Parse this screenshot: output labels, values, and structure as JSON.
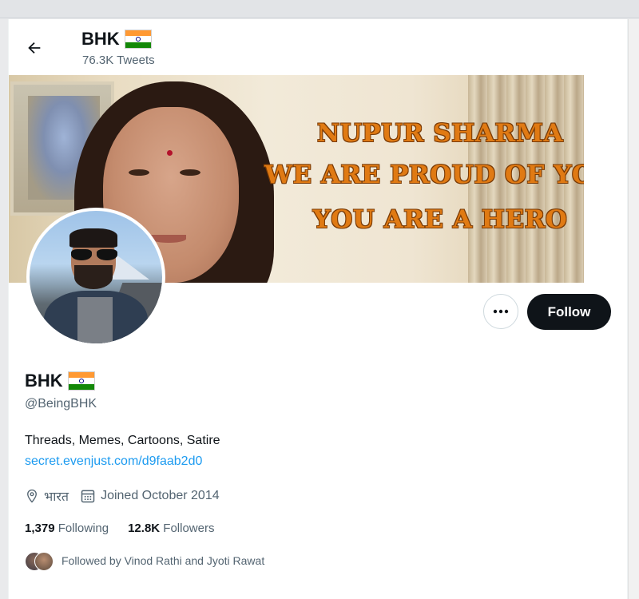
{
  "header": {
    "name": "BHK",
    "tweet_count": "76.3K Tweets"
  },
  "banner": {
    "line1": "NUPUR SHARMA",
    "line2": "WE ARE PROUD OF YOU",
    "line3": "YOU ARE A HERO"
  },
  "actions": {
    "more_icon": "more-dots-icon",
    "follow_label": "Follow"
  },
  "profile": {
    "name": "BHK",
    "handle": "@BeingBHK",
    "bio": "Threads, Memes, Cartoons, Satire",
    "link": "secret.evenjust.com/d9faab2d0",
    "location": "भारत",
    "joined": "Joined October 2014",
    "following_count": "1,379",
    "following_label": "Following",
    "followers_count": "12.8K",
    "followers_label": "Followers",
    "followed_by": "Followed by Vinod Rathi and Jyoti Rawat"
  },
  "colors": {
    "accent_link": "#1d9bf0",
    "follow_button": "#0f1419",
    "secondary_text": "#536471",
    "banner_text": "#e07a13"
  }
}
